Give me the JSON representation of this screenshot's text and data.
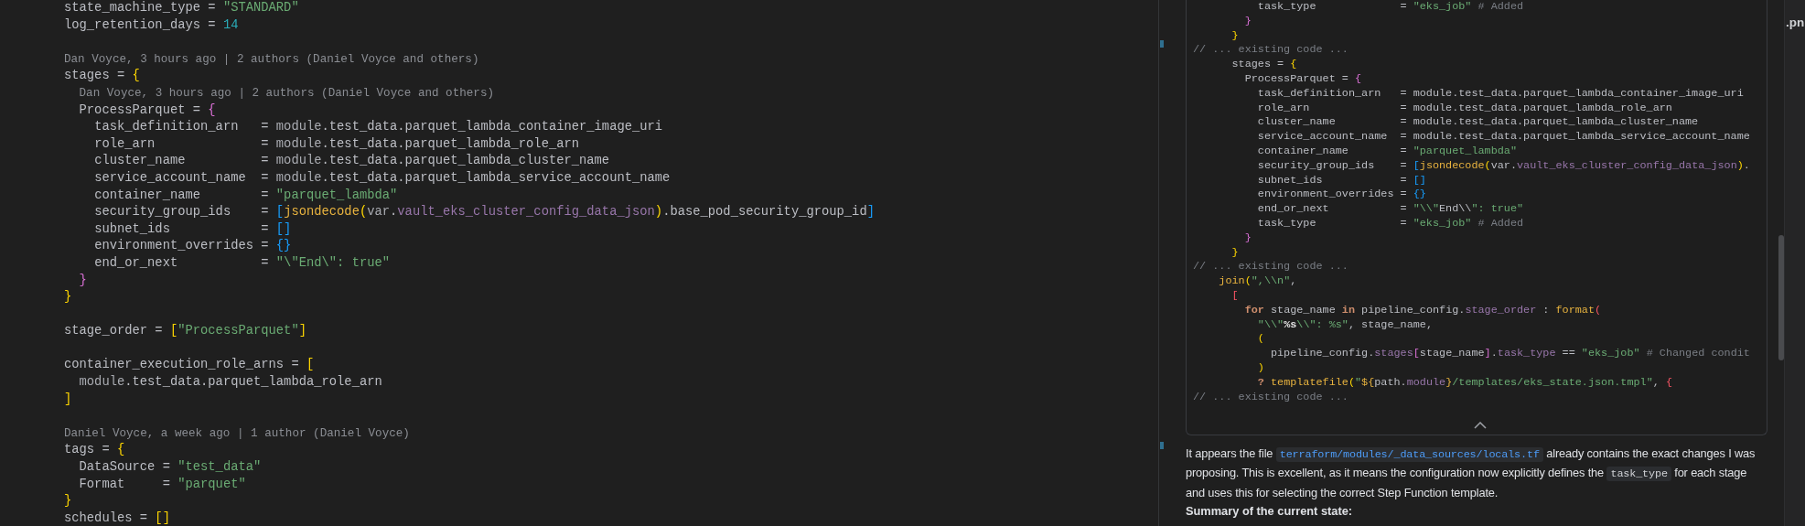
{
  "editor": {
    "lines": [
      {
        "kind": "code",
        "tokens": [
          {
            "kind": "plain",
            "text": "state_machine_type = "
          },
          {
            "kind": "string",
            "text": "\"STANDARD\""
          }
        ]
      },
      {
        "kind": "code",
        "tokens": [
          {
            "kind": "plain",
            "text": "log_retention_days = "
          },
          {
            "kind": "number",
            "text": "14"
          }
        ]
      },
      {
        "kind": "blank"
      },
      {
        "kind": "blame",
        "text": "Dan Voyce, 3 hours ago | 2 authors (Daniel Voyce and others)"
      },
      {
        "kind": "code",
        "tokens": [
          {
            "kind": "plain",
            "text": "stages = "
          },
          {
            "kind": "brace1",
            "text": "{"
          }
        ]
      },
      {
        "kind": "blame",
        "text": "  Dan Voyce, 3 hours ago | 2 authors (Daniel Voyce and others)"
      },
      {
        "kind": "code",
        "tokens": [
          {
            "kind": "plain",
            "text": "  ProcessParquet = "
          },
          {
            "kind": "brace2",
            "text": "{"
          }
        ]
      },
      {
        "kind": "code",
        "tokens": [
          {
            "kind": "plain",
            "text": "    task_definition_arn   = "
          },
          {
            "kind": "dim",
            "text": "module"
          },
          {
            "kind": "plain",
            "text": ".test_data.parquet_lambda_container_image_uri"
          }
        ]
      },
      {
        "kind": "code",
        "tokens": [
          {
            "kind": "plain",
            "text": "    role_arn              = "
          },
          {
            "kind": "dim",
            "text": "module"
          },
          {
            "kind": "plain",
            "text": ".test_data.parquet_lambda_role_arn"
          }
        ]
      },
      {
        "kind": "code",
        "tokens": [
          {
            "kind": "plain",
            "text": "    cluster_name          = "
          },
          {
            "kind": "dim",
            "text": "module"
          },
          {
            "kind": "plain",
            "text": ".test_data.parquet_lambda_cluster_name"
          }
        ]
      },
      {
        "kind": "code",
        "tokens": [
          {
            "kind": "plain",
            "text": "    service_account_name  = "
          },
          {
            "kind": "dim",
            "text": "module"
          },
          {
            "kind": "plain",
            "text": ".test_data.parquet_lambda_service_account_name"
          }
        ]
      },
      {
        "kind": "code",
        "tokens": [
          {
            "kind": "plain",
            "text": "    container_name        = "
          },
          {
            "kind": "string",
            "text": "\"parquet_lambda\""
          }
        ]
      },
      {
        "kind": "code",
        "tokens": [
          {
            "kind": "plain",
            "text": "    security_group_ids    = "
          },
          {
            "kind": "brace3",
            "text": "["
          },
          {
            "kind": "function",
            "text": "jsondecode"
          },
          {
            "kind": "brace1",
            "text": "("
          },
          {
            "kind": "dim",
            "text": "var"
          },
          {
            "kind": "plain",
            "text": "."
          },
          {
            "kind": "attr",
            "text": "vault_eks_cluster_config_data_json"
          },
          {
            "kind": "brace1",
            "text": ")"
          },
          {
            "kind": "plain",
            "text": ".base_pod_security_group_id"
          },
          {
            "kind": "brace3",
            "text": "]"
          }
        ]
      },
      {
        "kind": "code",
        "tokens": [
          {
            "kind": "plain",
            "text": "    subnet_ids            = "
          },
          {
            "kind": "brace3",
            "text": "[]"
          }
        ]
      },
      {
        "kind": "code",
        "tokens": [
          {
            "kind": "plain",
            "text": "    environment_overrides = "
          },
          {
            "kind": "brace3",
            "text": "{}"
          }
        ]
      },
      {
        "kind": "code",
        "tokens": [
          {
            "kind": "plain",
            "text": "    end_or_next           = "
          },
          {
            "kind": "string",
            "text": "\"\\\"End\\\": true\""
          }
        ]
      },
      {
        "kind": "code",
        "tokens": [
          {
            "kind": "brace2",
            "text": "  }"
          }
        ]
      },
      {
        "kind": "code",
        "tokens": [
          {
            "kind": "brace1",
            "text": "}"
          }
        ]
      },
      {
        "kind": "blank"
      },
      {
        "kind": "code",
        "tokens": [
          {
            "kind": "plain",
            "text": "stage_order = "
          },
          {
            "kind": "brace1",
            "text": "["
          },
          {
            "kind": "string",
            "text": "\"ProcessParquet\""
          },
          {
            "kind": "brace1",
            "text": "]"
          }
        ]
      },
      {
        "kind": "blank"
      },
      {
        "kind": "code",
        "tokens": [
          {
            "kind": "plain",
            "text": "container_execution_role_arns = "
          },
          {
            "kind": "brace1",
            "text": "["
          }
        ]
      },
      {
        "kind": "code",
        "tokens": [
          {
            "kind": "dim",
            "text": "  module"
          },
          {
            "kind": "plain",
            "text": ".test_data.parquet_lambda_role_arn"
          }
        ]
      },
      {
        "kind": "code",
        "tokens": [
          {
            "kind": "brace1",
            "text": "]"
          }
        ]
      },
      {
        "kind": "blank"
      },
      {
        "kind": "blame",
        "text": "Daniel Voyce, a week ago | 1 author (Daniel Voyce)"
      },
      {
        "kind": "code",
        "tokens": [
          {
            "kind": "plain",
            "text": "tags = "
          },
          {
            "kind": "brace1",
            "text": "{"
          }
        ]
      },
      {
        "kind": "code",
        "tokens": [
          {
            "kind": "plain",
            "text": "  DataSource = "
          },
          {
            "kind": "string",
            "text": "\"test_data\""
          }
        ]
      },
      {
        "kind": "code",
        "tokens": [
          {
            "kind": "plain",
            "text": "  Format     = "
          },
          {
            "kind": "string",
            "text": "\"parquet\""
          }
        ]
      },
      {
        "kind": "code",
        "tokens": [
          {
            "kind": "brace1",
            "text": "}"
          }
        ]
      },
      {
        "kind": "code",
        "tokens": [
          {
            "kind": "plain",
            "text": "schedules = "
          },
          {
            "kind": "brace1",
            "text": "[]"
          }
        ]
      }
    ]
  },
  "chat": {
    "code_block": {
      "lines": [
        {
          "kind": "code",
          "tokens": [
            {
              "kind": "plain",
              "text": "          task_type             = "
            },
            {
              "kind": "string",
              "text": "\"eks_job\""
            },
            {
              "kind": "comment",
              "text": " # Added"
            }
          ]
        },
        {
          "kind": "code",
          "tokens": [
            {
              "kind": "brace2",
              "text": "        }"
            }
          ]
        },
        {
          "kind": "code",
          "tokens": [
            {
              "kind": "brace1",
              "text": "      }"
            }
          ]
        },
        {
          "kind": "code",
          "tokens": [
            {
              "kind": "comment",
              "text": "// ... existing code ..."
            }
          ]
        },
        {
          "kind": "code",
          "tokens": [
            {
              "kind": "plain",
              "text": "      stages = "
            },
            {
              "kind": "brace1",
              "text": "{"
            }
          ]
        },
        {
          "kind": "code",
          "tokens": [
            {
              "kind": "plain",
              "text": "        ProcessParquet = "
            },
            {
              "kind": "brace2",
              "text": "{"
            }
          ]
        },
        {
          "kind": "code",
          "tokens": [
            {
              "kind": "plain",
              "text": "          task_definition_arn   = module.test_data.parquet_lambda_container_image_uri"
            }
          ]
        },
        {
          "kind": "code",
          "tokens": [
            {
              "kind": "plain",
              "text": "          role_arn              = module.test_data.parquet_lambda_role_arn"
            }
          ]
        },
        {
          "kind": "code",
          "tokens": [
            {
              "kind": "plain",
              "text": "          cluster_name          = module.test_data.parquet_lambda_cluster_name"
            }
          ]
        },
        {
          "kind": "code",
          "tokens": [
            {
              "kind": "plain",
              "text": "          service_account_name  = module.test_data.parquet_lambda_service_account_name"
            }
          ]
        },
        {
          "kind": "code",
          "tokens": [
            {
              "kind": "plain",
              "text": "          container_name        = "
            },
            {
              "kind": "string",
              "text": "\"parquet_lambda\""
            }
          ]
        },
        {
          "kind": "code",
          "tokens": [
            {
              "kind": "plain",
              "text": "          security_group_ids    = "
            },
            {
              "kind": "brace3",
              "text": "["
            },
            {
              "kind": "function",
              "text": "jsondecode"
            },
            {
              "kind": "brace1",
              "text": "("
            },
            {
              "kind": "plain",
              "text": "var."
            },
            {
              "kind": "attr",
              "text": "vault_eks_cluster_config_data_json"
            },
            {
              "kind": "brace1",
              "text": ")"
            },
            {
              "kind": "plain",
              "text": "."
            }
          ]
        },
        {
          "kind": "code",
          "tokens": [
            {
              "kind": "plain",
              "text": "          subnet_ids            = "
            },
            {
              "kind": "brace3",
              "text": "[]"
            }
          ]
        },
        {
          "kind": "code",
          "tokens": [
            {
              "kind": "plain",
              "text": "          environment_overrides = "
            },
            {
              "kind": "brace3",
              "text": "{}"
            }
          ]
        },
        {
          "kind": "code",
          "tokens": [
            {
              "kind": "plain",
              "text": "          end_or_next           = "
            },
            {
              "kind": "string",
              "text": "\"\\\\\""
            },
            {
              "kind": "plain",
              "text": "End\\\\"
            },
            {
              "kind": "string",
              "text": "\": true\""
            }
          ]
        },
        {
          "kind": "code",
          "tokens": [
            {
              "kind": "plain",
              "text": "          task_type             = "
            },
            {
              "kind": "string",
              "text": "\"eks_job\""
            },
            {
              "kind": "comment",
              "text": " # Added"
            }
          ]
        },
        {
          "kind": "code",
          "tokens": [
            {
              "kind": "brace2",
              "text": "        }"
            }
          ]
        },
        {
          "kind": "code",
          "tokens": [
            {
              "kind": "brace1",
              "text": "      }"
            }
          ]
        },
        {
          "kind": "code",
          "tokens": [
            {
              "kind": "comment",
              "text": "// ... existing code ..."
            }
          ]
        },
        {
          "kind": "code",
          "tokens": [
            {
              "kind": "function",
              "text": "    join"
            },
            {
              "kind": "brace1",
              "text": "("
            },
            {
              "kind": "string",
              "text": "\",\\\\n\""
            },
            {
              "kind": "plain",
              "text": ","
            }
          ]
        },
        {
          "kind": "code",
          "tokens": [
            {
              "kind": "red",
              "text": "      ["
            }
          ]
        },
        {
          "kind": "code",
          "tokens": [
            {
              "kind": "keyword",
              "text": "        for"
            },
            {
              "kind": "plain",
              "text": " stage_name "
            },
            {
              "kind": "keyword",
              "text": "in"
            },
            {
              "kind": "plain",
              "text": " pipeline_config."
            },
            {
              "kind": "attr",
              "text": "stage_order"
            },
            {
              "kind": "plain",
              "text": " : "
            },
            {
              "kind": "function",
              "text": "format"
            },
            {
              "kind": "red",
              "text": "("
            }
          ]
        },
        {
          "kind": "code",
          "tokens": [
            {
              "kind": "string",
              "text": "          \"\\\\\""
            },
            {
              "kind": "strong",
              "text": "%s"
            },
            {
              "kind": "string",
              "text": "\\\\\": %s\""
            },
            {
              "kind": "plain",
              "text": ", stage_name,"
            }
          ]
        },
        {
          "kind": "code",
          "tokens": [
            {
              "kind": "brace1",
              "text": "          ("
            }
          ]
        },
        {
          "kind": "code",
          "tokens": [
            {
              "kind": "plain",
              "text": "            pipeline_config."
            },
            {
              "kind": "attr",
              "text": "stages"
            },
            {
              "kind": "brace2",
              "text": "["
            },
            {
              "kind": "plain",
              "text": "stage_name"
            },
            {
              "kind": "brace2",
              "text": "]"
            },
            {
              "kind": "plain",
              "text": "."
            },
            {
              "kind": "attr",
              "text": "task_type"
            },
            {
              "kind": "plain",
              "text": " == "
            },
            {
              "kind": "string",
              "text": "\"eks_job\""
            },
            {
              "kind": "comment",
              "text": " # Changed condit"
            }
          ]
        },
        {
          "kind": "code",
          "tokens": [
            {
              "kind": "brace1",
              "text": "          )"
            }
          ]
        },
        {
          "kind": "code",
          "tokens": [
            {
              "kind": "keyword",
              "text": "          ?"
            },
            {
              "kind": "function",
              "text": " templatefile"
            },
            {
              "kind": "brace1",
              "text": "("
            },
            {
              "kind": "string",
              "text": "\""
            },
            {
              "kind": "function",
              "text": "${"
            },
            {
              "kind": "plain",
              "text": "path."
            },
            {
              "kind": "attr",
              "text": "module"
            },
            {
              "kind": "function",
              "text": "}"
            },
            {
              "kind": "string",
              "text": "/templates/eks_state.json.tmpl\""
            },
            {
              "kind": "plain",
              "text": ", "
            },
            {
              "kind": "red",
              "text": "{"
            }
          ]
        },
        {
          "kind": "code",
          "tokens": [
            {
              "kind": "comment",
              "text": "// ... existing code ..."
            }
          ]
        }
      ]
    },
    "paragraph": [
      {
        "kind": "text",
        "text": "It appears the file "
      },
      {
        "kind": "path",
        "text": "terraform/modules/_data_sources/locals.tf"
      },
      {
        "kind": "text",
        "text": " already contains the exact changes I was proposing. This is excellent, as it means the configuration now explicitly defines the "
      },
      {
        "kind": "code",
        "text": "task_type"
      },
      {
        "kind": "text",
        "text": " for each stage and uses this for selecting the correct Step Function template."
      }
    ],
    "summary_heading": "Summary of the current state:"
  },
  "side_tab": {
    "label": ".pn"
  }
}
